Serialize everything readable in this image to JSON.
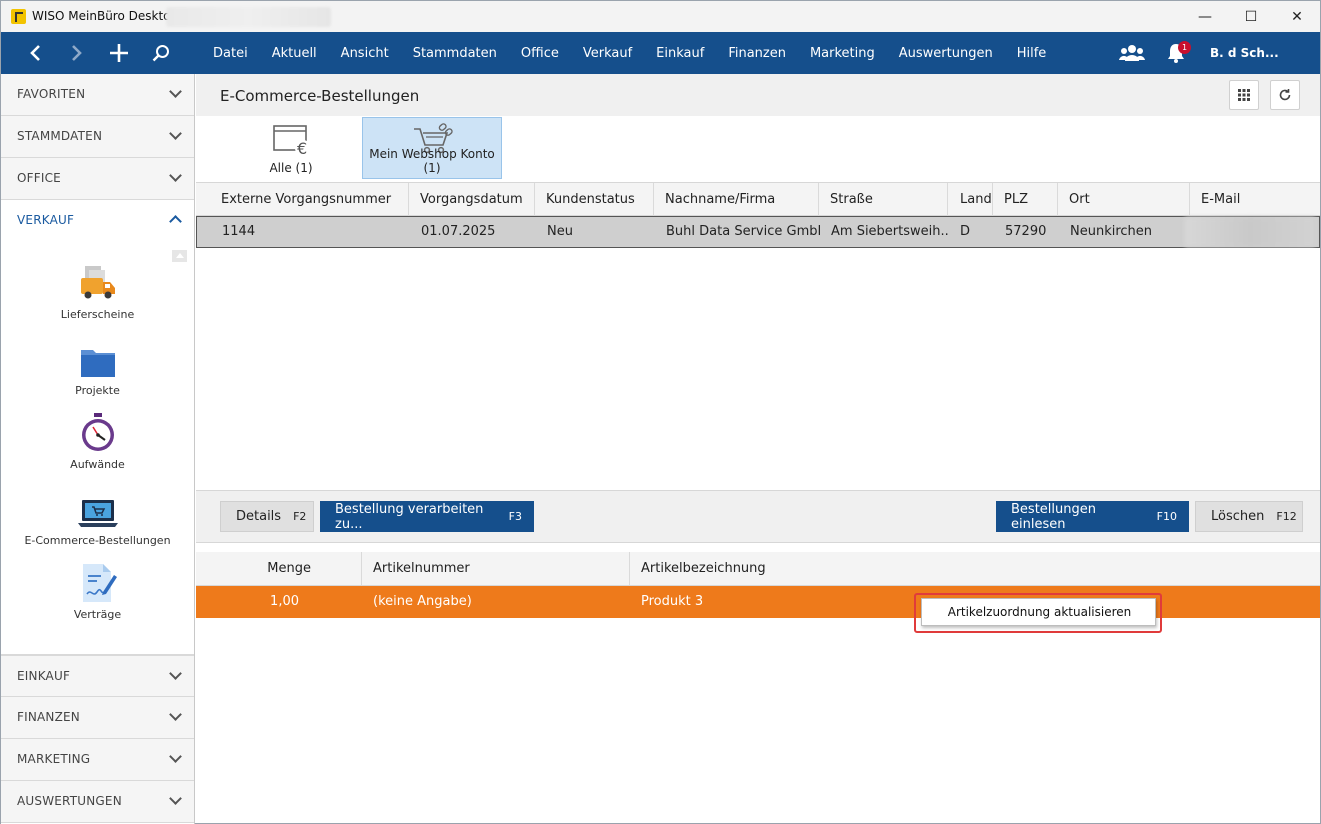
{
  "window": {
    "title": "WISO MeinBüro Desktop",
    "controls": {
      "minimize": "—",
      "maximize": "☐",
      "close": "✕"
    }
  },
  "navbar": {
    "menu": [
      "Datei",
      "Aktuell",
      "Ansicht",
      "Stammdaten",
      "Office",
      "Verkauf",
      "Einkauf",
      "Finanzen",
      "Marketing",
      "Auswertungen",
      "Hilfe"
    ],
    "notification_count": "1",
    "user": "B. d Sch..."
  },
  "sidebar": {
    "sections": {
      "favoriten": "FAVORITEN",
      "stammdaten": "STAMMDATEN",
      "office": "OFFICE",
      "verkauf": "VERKAUF",
      "einkauf": "EINKAUF",
      "finanzen": "FINANZEN",
      "marketing": "MARKETING",
      "auswertungen": "AUSWERTUNGEN"
    },
    "verkauf_items": {
      "lieferscheine": "Lieferscheine",
      "projekte": "Projekte",
      "aufwaende": "Aufwände",
      "ecommerce": "E-Commerce-Bestellungen",
      "vertraege": "Verträge"
    }
  },
  "page": {
    "title": "E-Commerce-Bestellungen",
    "tiles": {
      "all": "Alle (1)",
      "webshop": "Mein Webshop Konto (1)"
    }
  },
  "orders": {
    "columns": {
      "ext_nr": "Externe Vorgangsnummer",
      "date": "Vorgangsdatum",
      "status": "Kundenstatus",
      "name": "Nachname/Firma",
      "street": "Straße",
      "country": "Land",
      "zip": "PLZ",
      "city": "Ort",
      "email": "E-Mail"
    },
    "row": {
      "ext_nr": "1144",
      "date": "01.07.2025",
      "status": "Neu",
      "name": "Buhl Data Service GmbH",
      "street": "Am Siebertsweih...",
      "country": "D",
      "zip": "57290",
      "city": "Neunkirchen"
    }
  },
  "actions": {
    "details": {
      "label": "Details",
      "key": "F2"
    },
    "process": {
      "label": "Bestellung verarbeiten zu...",
      "key": "F3"
    },
    "import": {
      "label": "Bestellungen einlesen",
      "key": "F10"
    },
    "delete": {
      "label": "Löschen",
      "key": "F12"
    }
  },
  "items": {
    "columns": {
      "qty": "Menge",
      "artnr": "Artikelnummer",
      "desc": "Artikelbezeichnung"
    },
    "row": {
      "qty": "1,00",
      "artnr": "(keine Angabe)",
      "desc": "Produkt 3"
    }
  },
  "context_menu": {
    "item": "Artikelzuordnung aktualisieren"
  },
  "colors": {
    "nav_blue": "#154f8c",
    "accent_orange": "#ee7a1b",
    "selected_tile": "#cde3f6",
    "highlight_red": "#e03b3b"
  }
}
